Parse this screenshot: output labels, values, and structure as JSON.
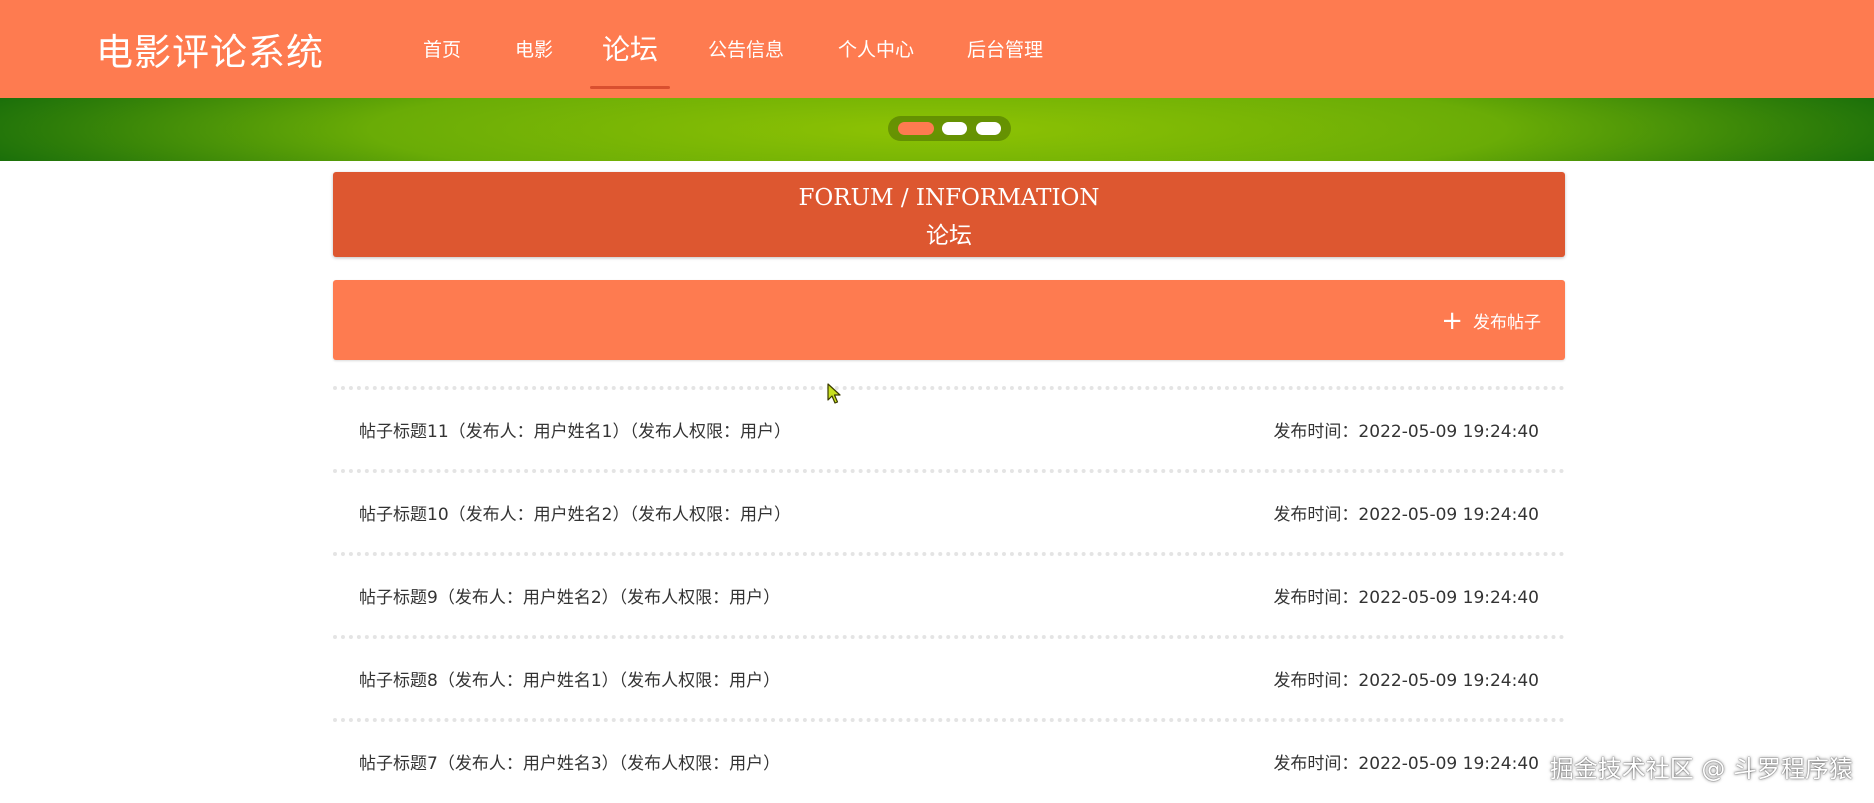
{
  "header": {
    "site_title": "电影评论系统",
    "nav": [
      {
        "label": "首页",
        "active": false
      },
      {
        "label": "电影",
        "active": false
      },
      {
        "label": "论坛",
        "active": true
      },
      {
        "label": "公告信息",
        "active": false
      },
      {
        "label": "个人中心",
        "active": false
      },
      {
        "label": "后台管理",
        "active": false
      }
    ]
  },
  "banner": {
    "carousel_dots": 3,
    "active_dot": 1
  },
  "section": {
    "title_en": "FORUM / INFORMATION",
    "title_cn": "论坛"
  },
  "actions": {
    "new_post_label": "发布帖子",
    "new_post_icon": "plus-icon"
  },
  "posts": [
    {
      "title": "帖子标题11（发布人：用户姓名1）（发布人权限：用户）",
      "time": "发布时间：2022-05-09 19:24:40"
    },
    {
      "title": "帖子标题10（发布人：用户姓名2）（发布人权限：用户）",
      "time": "发布时间：2022-05-09 19:24:40"
    },
    {
      "title": "帖子标题9（发布人：用户姓名2）（发布人权限：用户）",
      "time": "发布时间：2022-05-09 19:24:40"
    },
    {
      "title": "帖子标题8（发布人：用户姓名1）（发布人权限：用户）",
      "time": "发布时间：2022-05-09 19:24:40"
    },
    {
      "title": "帖子标题7（发布人：用户姓名3）（发布人权限：用户）",
      "time": "发布时间：2022-05-09 19:24:40"
    }
  ],
  "watermark": "掘金技术社区 @ 斗罗程序猿",
  "colors": {
    "primary": "#fe7b50",
    "heading": "#dd5730",
    "banner_green": "#6aac06",
    "text": "#333333"
  }
}
